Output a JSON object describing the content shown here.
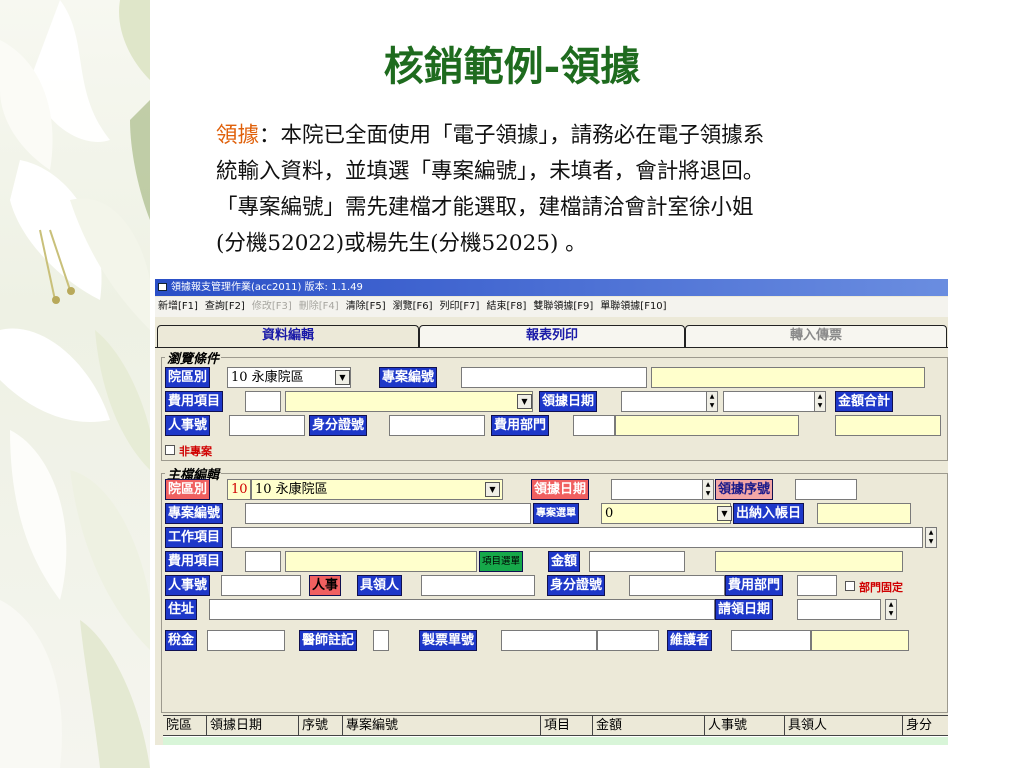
{
  "slide": {
    "title": "核銷範例-領據",
    "highlight": "領據",
    "line1_rest": "：本院已全面使用「電子領據」，請務必在電子領據系",
    "line2": "統輸入資料，並填選「專案編號」，未填者，會計將退回。",
    "line3": "「專案編號」需先建檔才能選取，建檔請洽會計室徐小姐",
    "line4": "(分機52022)或楊先生(分機52025) 。"
  },
  "window": {
    "title": "領據報支管理作業(acc2011)  版本: 1.1.49",
    "menu": [
      {
        "label": "新增[F1]",
        "enabled": true
      },
      {
        "label": "查詢[F2]",
        "enabled": true
      },
      {
        "label": "修改[F3]",
        "enabled": false
      },
      {
        "label": "刪除[F4]",
        "enabled": false
      },
      {
        "label": "清除[F5]",
        "enabled": true
      },
      {
        "label": "瀏覽[F6]",
        "enabled": true
      },
      {
        "label": "列印[F7]",
        "enabled": true
      },
      {
        "label": "結束[F8]",
        "enabled": true
      },
      {
        "label": "雙聯領據[F9]",
        "enabled": true
      },
      {
        "label": "單聯領據[F10]",
        "enabled": true
      }
    ],
    "tabs": [
      "資料編輯",
      "報表列印",
      "轉入傳票"
    ],
    "browse": {
      "group_title": "瀏覽條件",
      "campus_label": "院區別",
      "campus_value": "10 永康院區",
      "project_label": "專案編號",
      "expense_item_label": "費用項目",
      "receipt_date_label": "領據日期",
      "total_amount_label": "金額合計",
      "personnel_label": "人事號",
      "id_label": "身分證號",
      "dept_label": "費用部門",
      "non_project_label": "非專案"
    },
    "main": {
      "group_title": "主檔編輯",
      "campus_label": "院區別",
      "campus_code": "10",
      "campus_value": "10 永康院區",
      "receipt_date_label": "領據日期",
      "receipt_seq_label": "領據序號",
      "project_label": "專案編號",
      "project_select_label": "專案選單",
      "project_select_value": "0",
      "account_label": "出納入帳日",
      "work_item_label": "工作項目",
      "expense_item_label": "費用項目",
      "item_select_label": "項目選單",
      "amount_label": "金額",
      "personnel_label": "人事號",
      "personnel_btn": "人事",
      "receiver_label": "具領人",
      "id_label": "身分證號",
      "dept_label": "費用部門",
      "dept_fixed_label": "部門固定",
      "address_label": "住址",
      "apply_date_label": "請領日期",
      "tax_label": "稅金",
      "doctor_label": "醫師註記",
      "voucher_label": "製票單號",
      "maintainer_label": "維護者"
    },
    "grid_columns": [
      "院區",
      "領據日期",
      "序號",
      "專案編號",
      "項目",
      "金額",
      "人事號",
      "具領人",
      "身分"
    ]
  },
  "colors": {
    "title_green": "#1e6b1e",
    "highlight_orange": "#e0600a",
    "label_blue": "#1e38c9",
    "label_red": "#f06060",
    "field_yellow": "#ffffcc"
  }
}
